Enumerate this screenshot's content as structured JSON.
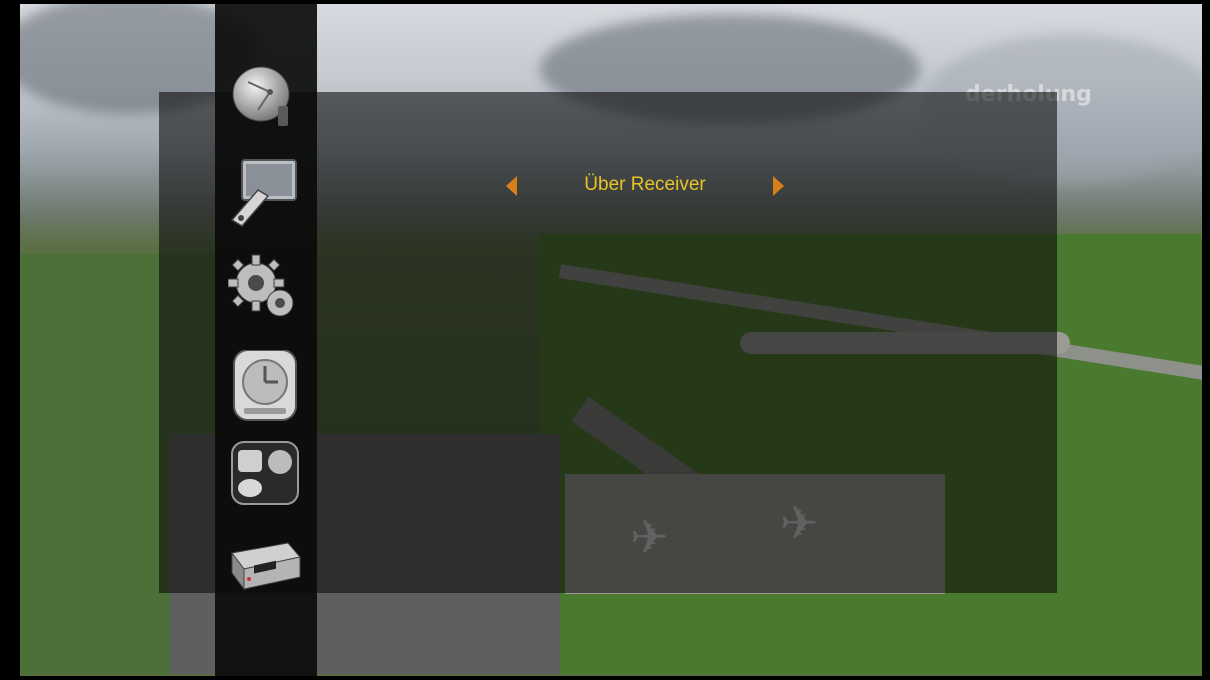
{
  "overlay": {
    "channel_watermark": "derholung"
  },
  "menu": {
    "title": "Über Receiver",
    "prev_arrow_icon": "arrow-left-icon",
    "next_arrow_icon": "arrow-right-icon",
    "items": [
      {
        "icon": "satellite-dish-icon"
      },
      {
        "icon": "tv-picture-settings-icon"
      },
      {
        "icon": "gears-settings-icon"
      },
      {
        "icon": "clock-timer-icon"
      },
      {
        "icon": "network-media-icon"
      },
      {
        "icon": "receiver-box-icon"
      }
    ]
  },
  "colors": {
    "title_text": "#e9c32a",
    "arrow": "#d77f18",
    "panel": "rgba(10,10,10,0.58)"
  }
}
